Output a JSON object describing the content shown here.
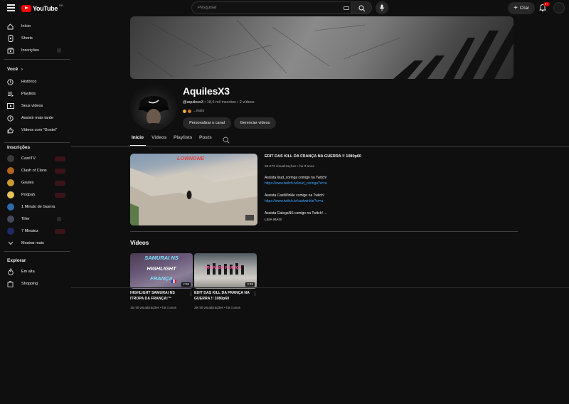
{
  "header": {
    "logo_text": "YouTube",
    "country_code": "BR",
    "search_placeholder": "Pesquisar",
    "create_label": "Criar",
    "notif_count": "9+"
  },
  "sidebar": {
    "main": [
      {
        "label": "Início",
        "icon": "home-icon"
      },
      {
        "label": "Shorts",
        "icon": "shorts-icon"
      },
      {
        "label": "Inscrições",
        "icon": "subscriptions-icon"
      }
    ],
    "you_heading": "Você",
    "you": [
      {
        "label": "Histórico",
        "icon": "history-icon"
      },
      {
        "label": "Playlists",
        "icon": "playlists-icon"
      },
      {
        "label": "Seus vídeos",
        "icon": "your-videos-icon"
      },
      {
        "label": "Assistir mais tarde",
        "icon": "watch-later-icon"
      },
      {
        "label": "Vídeos com \"Gostei\"",
        "icon": "like-icon"
      }
    ],
    "subs_heading": "Inscrições",
    "subs": [
      {
        "label": "CazéTV",
        "color": "#3b3b3b"
      },
      {
        "label": "Clash of Clans",
        "color": "#b5651d"
      },
      {
        "label": "Gaules",
        "color": "#c99a2e"
      },
      {
        "label": "Podpah",
        "color": "#e8c15a"
      },
      {
        "label": "1 Minuto de Guerra",
        "color": "#2b6cb0"
      },
      {
        "label": "Tiller",
        "color": "#444a5a"
      },
      {
        "label": "7 Minutoz",
        "color": "#1f2a66"
      }
    ],
    "show_more": "Mostrar mais",
    "explore_heading": "Explorar",
    "explore": [
      {
        "label": "Em alta",
        "icon": "trending-icon"
      },
      {
        "label": "Shopping",
        "icon": "shopping-icon"
      }
    ]
  },
  "channel": {
    "name": "AquilesX3",
    "handle": "@aquilesx3",
    "meta_rest": " • 18,6 mil inscritos • 2 vídeos",
    "description": "...mais",
    "customize_label": "Personalizar o canal",
    "manage_label": "Gerenciar vídeos"
  },
  "tabs": [
    "Início",
    "Vídeos",
    "Playlists",
    "Posts"
  ],
  "featured": {
    "title": "EDIT DAS KILL DA FRANÇA NA GUERRA !! 1080p60",
    "stats": "39.072 visualizações • há 3 anos",
    "thumb_text": "LOWNONE",
    "lines": [
      {
        "text": "Assista loud_coringa comigo na Twitch!",
        "link": "https://www.twitch.tv/loud_coringa?sr=a"
      },
      {
        "text": "Assista CastWinkle comigo na Twitch!",
        "link": "https://www.twitch.tv/castwinkle?sr=a"
      },
      {
        "text": "Assista GalegaNS comigo na Twitch! ...",
        "link": ""
      }
    ],
    "read_more": "LEIA MAIS"
  },
  "videos_section": {
    "title": "Vídeos",
    "items": [
      {
        "title": "HIGHLIGHT SAMURAI NS ITROPA DA FRANÇA!™",
        "meta": "16 mil visualizações • há 3 anos",
        "duration": "2:59",
        "thumb_lines": [
          "SAMURAI NS",
          "HIGHLIGHT",
          "FRANÇA"
        ]
      },
      {
        "title": "EDIT DAS KILL DA FRANÇA NA GUERRA !! 1080p60",
        "meta": "39 mil visualizações • há 3 anos",
        "duration": "3:49",
        "thumb_lines": [
          "TROPA DA FRANÇA"
        ]
      }
    ]
  }
}
